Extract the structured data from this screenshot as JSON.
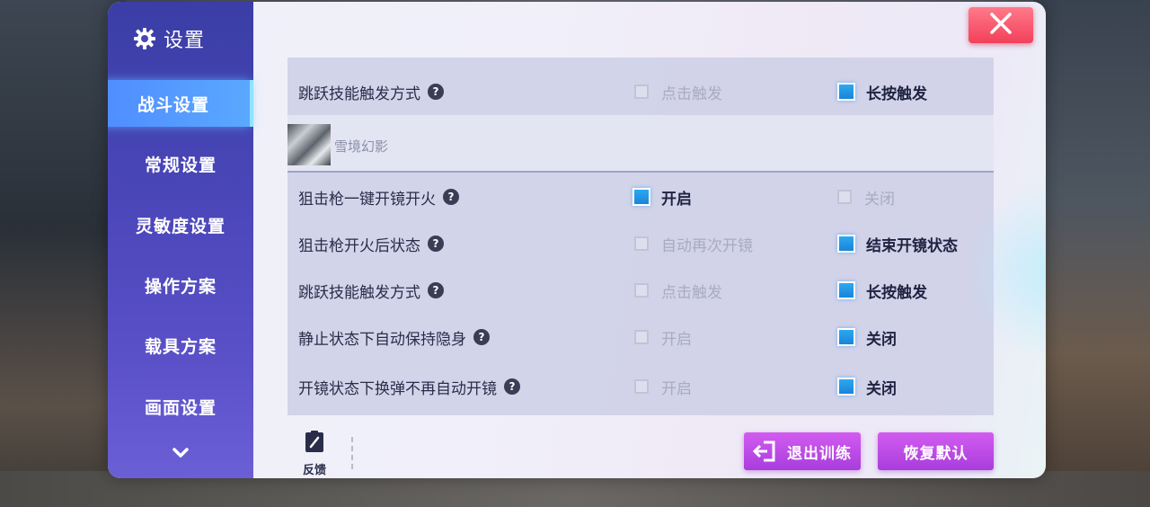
{
  "sidebar": {
    "title": "设置",
    "items": [
      {
        "label": "战斗设置",
        "active": true
      },
      {
        "label": "常规设置",
        "active": false
      },
      {
        "label": "灵敏度设置",
        "active": false
      },
      {
        "label": "操作方案",
        "active": false
      },
      {
        "label": "载具方案",
        "active": false
      },
      {
        "label": "画面设置",
        "active": false
      }
    ],
    "more_icon": "chevron-down-icon"
  },
  "close_icon": "close-icon",
  "top_row": {
    "label": "跳跃技能触发方式",
    "opt_a": "点击触发",
    "opt_a_checked": false,
    "opt_b": "长按触发",
    "opt_b_checked": true
  },
  "section": {
    "name": "雪境幻影"
  },
  "rows": [
    {
      "label": "狙击枪一键开镜开火",
      "opt_a": "开启",
      "opt_a_checked": true,
      "opt_b": "关闭",
      "opt_b_checked": false
    },
    {
      "label": "狙击枪开火后状态",
      "opt_a": "自动再次开镜",
      "opt_a_checked": false,
      "opt_b": "结束开镜状态",
      "opt_b_checked": true
    },
    {
      "label": "跳跃技能触发方式",
      "opt_a": "点击触发",
      "opt_a_checked": false,
      "opt_b": "长按触发",
      "opt_b_checked": true
    },
    {
      "label": "静止状态下自动保持隐身",
      "opt_a": "开启",
      "opt_a_checked": false,
      "opt_b": "关闭",
      "opt_b_checked": true
    },
    {
      "label": "开镜状态下换弹不再自动开镜",
      "opt_a": "开启",
      "opt_a_checked": false,
      "opt_b": "关闭",
      "opt_b_checked": true
    }
  ],
  "footer": {
    "feedback_label": "反馈",
    "exit_label": "退出训练",
    "reset_label": "恢复默认"
  },
  "colors": {
    "accent_blue": "#1a84d8",
    "button_purple": "#a83ddc",
    "close_red": "#f2405a",
    "sidebar": "#4a46b8"
  }
}
